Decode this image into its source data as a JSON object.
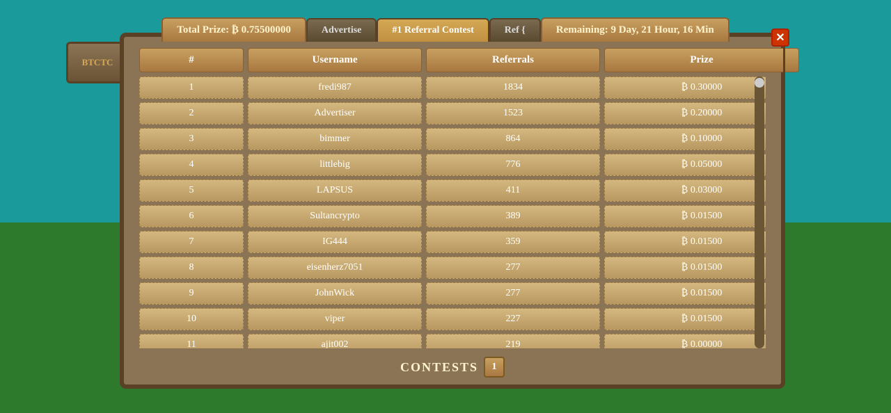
{
  "nav": {
    "total_prize_label": "Total Prize: ₿ 0.75500000",
    "advertise_label": "Advertise",
    "title": "#1 Referral Contest",
    "ref_label": "Ref {",
    "remaining_label": "Remaining: 9 Day, 21 Hour, 16 Min",
    "close_label": "✕"
  },
  "table": {
    "headers": [
      "#",
      "Username",
      "Referrals",
      "Prize"
    ],
    "rows": [
      {
        "rank": "1",
        "username": "fredi987",
        "referrals": "1834",
        "prize": "₿ 0.30000"
      },
      {
        "rank": "2",
        "username": "Advertiser",
        "referrals": "1523",
        "prize": "₿ 0.20000"
      },
      {
        "rank": "3",
        "username": "bimmer",
        "referrals": "864",
        "prize": "₿ 0.10000"
      },
      {
        "rank": "4",
        "username": "littlebig",
        "referrals": "776",
        "prize": "₿ 0.05000"
      },
      {
        "rank": "5",
        "username": "LAPSUS",
        "referrals": "411",
        "prize": "₿ 0.03000"
      },
      {
        "rank": "6",
        "username": "Sultancrypto",
        "referrals": "389",
        "prize": "₿ 0.01500"
      },
      {
        "rank": "7",
        "username": "IG444",
        "referrals": "359",
        "prize": "₿ 0.01500"
      },
      {
        "rank": "8",
        "username": "eisenherz7051",
        "referrals": "277",
        "prize": "₿ 0.01500"
      },
      {
        "rank": "9",
        "username": "JohnWick",
        "referrals": "277",
        "prize": "₿ 0.01500"
      },
      {
        "rank": "10",
        "username": "viper",
        "referrals": "227",
        "prize": "₿ 0.01500"
      },
      {
        "rank": "11",
        "username": "ajit002",
        "referrals": "219",
        "prize": "₿ 0.00000"
      }
    ]
  },
  "pagination": {
    "label": "CONTESTS",
    "current_page": "1"
  },
  "sign": {
    "text": "BTCTC"
  }
}
